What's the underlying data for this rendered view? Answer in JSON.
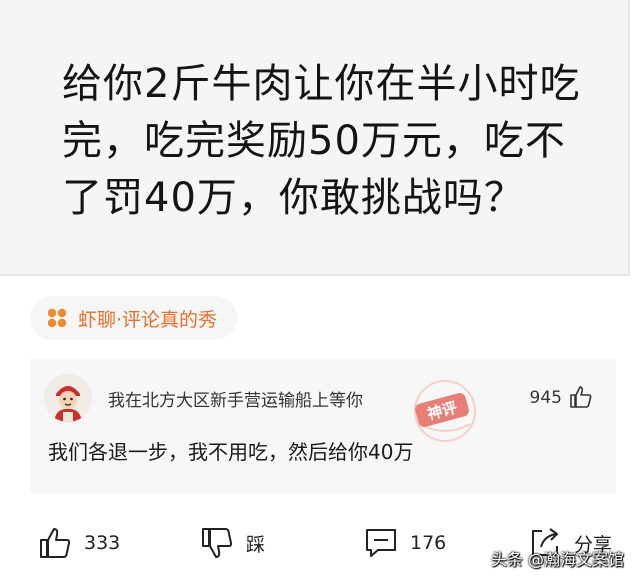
{
  "post": {
    "text": "给你2斤牛肉让你在半小时吃完，吃完奖励50万元，吃不了罚40万，你敢挑战吗？"
  },
  "topic": {
    "label": "虾聊·评论真的秀",
    "icon": "flower-dots-icon"
  },
  "comment": {
    "username": "我在北方大区新手营运输船上等你",
    "like_count": "945",
    "text": "我们各退一步，我不用吃，然后给你40万",
    "badge": "神评"
  },
  "actions": {
    "like_count": "333",
    "dislike_label": "踩",
    "comment_count": "176",
    "share_label": "分享"
  },
  "watermark": "头条 @瀚海文案馆",
  "colors": {
    "topic_accent": "#e8702a",
    "badge_red": "#e3584d"
  }
}
